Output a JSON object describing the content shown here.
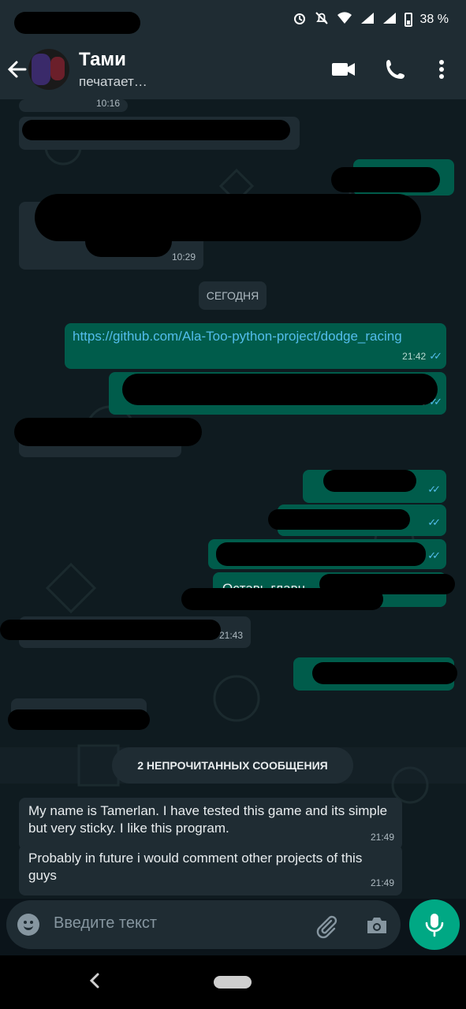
{
  "status_bar": {
    "battery": "38 %",
    "icons": [
      "alarm-icon",
      "bell-off-icon",
      "wifi-icon",
      "signal-icon",
      "signal-icon",
      "battery-icon"
    ]
  },
  "header": {
    "name": "Тами",
    "status": "печатает…",
    "icons": [
      "back-arrow-icon",
      "video-call-icon",
      "phone-icon",
      "more-vert-icon"
    ]
  },
  "messages": {
    "m1_time": "10:16",
    "m2_time": "10:29",
    "date_label": "СЕГОДНЯ",
    "link": "https://github.com/Ala-Too-python-project/dodge_racing",
    "link_time": "21:42",
    "m4_time": "21:43",
    "m5_text": "Оставь главн",
    "m6_time": "21:43",
    "unread_label": "2 НЕПРОЧИТАННЫХ СООБЩЕНИЯ",
    "u1_text": "My name is Tamerlan. I have tested this  game and its simple but very sticky. I like this program.",
    "u1_time": "21:49",
    "u2_text": "Probably in future i would comment other projects of this guys",
    "u2_time": "21:49"
  },
  "composer": {
    "placeholder": "Введите текст",
    "icons": [
      "emoji-icon",
      "attach-icon",
      "camera-icon",
      "mic-icon"
    ]
  },
  "colors": {
    "header": "#1f2c33",
    "incoming": "#1f2c33",
    "outgoing": "#005c4b",
    "accent": "#00a884",
    "ticks": "#53bdeb"
  }
}
